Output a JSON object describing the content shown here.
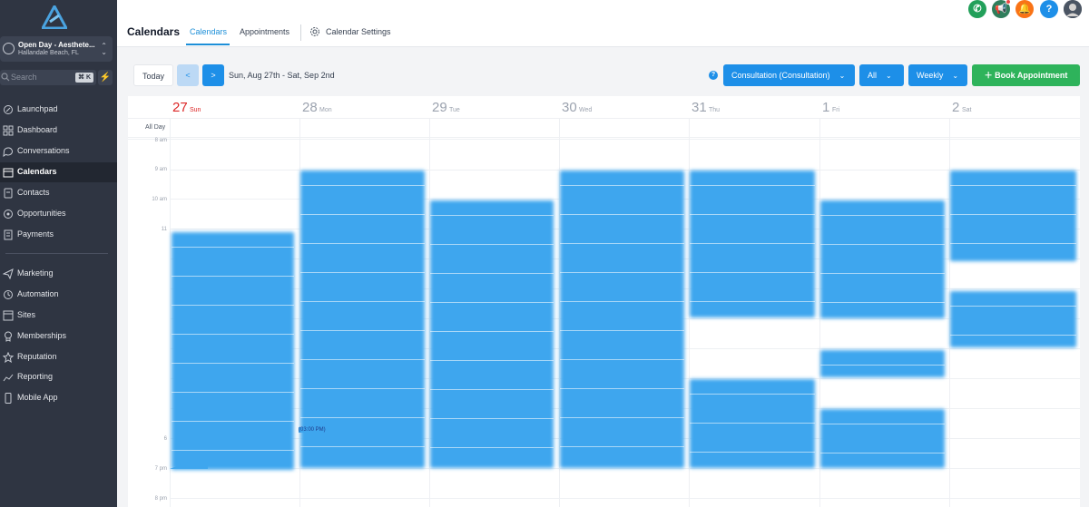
{
  "sidebar": {
    "location": {
      "name": "Open Day - Aesthete...",
      "city": "Hallandale Beach, FL"
    },
    "search": {
      "placeholder": "Search",
      "shortcut": "⌘ K"
    },
    "nav_primary": [
      {
        "label": "Launchpad",
        "icon": "rocket-icon"
      },
      {
        "label": "Dashboard",
        "icon": "dashboard-icon"
      },
      {
        "label": "Conversations",
        "icon": "chat-icon"
      },
      {
        "label": "Calendars",
        "icon": "calendar-icon",
        "active": true
      },
      {
        "label": "Contacts",
        "icon": "contacts-icon"
      },
      {
        "label": "Opportunities",
        "icon": "opportunities-icon"
      },
      {
        "label": "Payments",
        "icon": "payments-icon"
      }
    ],
    "nav_secondary": [
      {
        "label": "Marketing",
        "icon": "send-icon"
      },
      {
        "label": "Automation",
        "icon": "automation-icon"
      },
      {
        "label": "Sites",
        "icon": "sites-icon"
      },
      {
        "label": "Memberships",
        "icon": "membership-icon"
      },
      {
        "label": "Reputation",
        "icon": "star-icon"
      },
      {
        "label": "Reporting",
        "icon": "chart-icon"
      },
      {
        "label": "Mobile App",
        "icon": "mobile-icon"
      }
    ]
  },
  "header": {
    "title": "Calendars",
    "tabs": [
      {
        "label": "Calendars",
        "active": true
      },
      {
        "label": "Appointments"
      },
      {
        "label": "Calendar Settings"
      }
    ],
    "actions": [
      {
        "icon": "phone-icon",
        "color": "#22a05a"
      },
      {
        "icon": "megaphone-icon",
        "color": "#2f7d5b"
      },
      {
        "icon": "bell-icon",
        "color": "#f97316"
      },
      {
        "icon": "help-icon",
        "color": "#1d8fe8",
        "glyph": "?"
      },
      {
        "icon": "avatar"
      }
    ]
  },
  "toolbar": {
    "today_label": "Today",
    "prev_label": "<",
    "next_label": ">",
    "date_range": "Sun, Aug 27th - Sat, Sep 2nd",
    "calendar_select": "Consultation (Consultation)",
    "filter_select": "All",
    "view_select": "Weekly",
    "book_label": "Book Appointment"
  },
  "calendar": {
    "all_day_label": "All Day",
    "days": [
      {
        "num": "27",
        "name": "Sun",
        "today": true
      },
      {
        "num": "28",
        "name": "Mon"
      },
      {
        "num": "29",
        "name": "Tue"
      },
      {
        "num": "30",
        "name": "Wed"
      },
      {
        "num": "31",
        "name": "Thu"
      },
      {
        "num": "1",
        "name": "Fri"
      },
      {
        "num": "2",
        "name": "Sat"
      }
    ],
    "time_labels": [
      "8 am",
      "9 am",
      "10 am",
      "11",
      "6",
      "7 pm",
      "8 pm"
    ],
    "now_label": "(03:00 PM)"
  },
  "colors": {
    "sidebar_bg": "#2f3542",
    "accent": "#1d8fe8",
    "event": "#3ea6ee",
    "book_button": "#2eb35b",
    "today": "#dc2626"
  }
}
